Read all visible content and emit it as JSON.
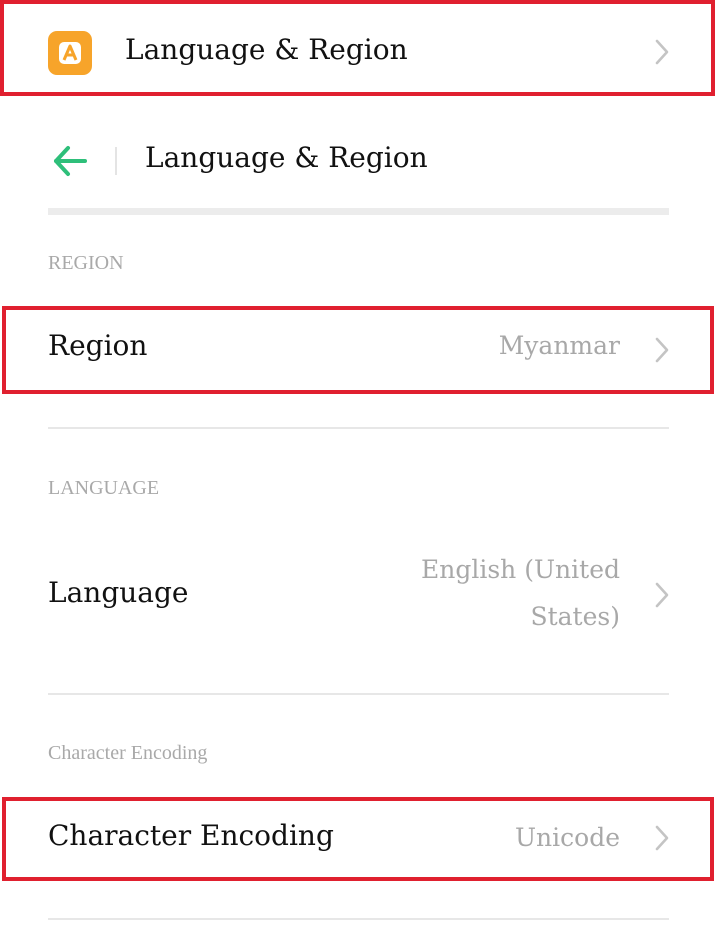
{
  "top_item": {
    "title": "Language & Region",
    "icon": "app-logo-icon",
    "accent": "#f7a42a"
  },
  "header": {
    "back_icon": "back-arrow-icon",
    "title": "Language & Region",
    "accent": "#2ebf7a"
  },
  "sections": {
    "region": {
      "label": "REGION",
      "row": {
        "label": "Region",
        "value": "Myanmar"
      }
    },
    "language": {
      "label": "LANGUAGE",
      "row": {
        "label": "Language",
        "value_line1": "English (United",
        "value_line2": "States)"
      }
    },
    "encoding": {
      "label": "Character Encoding",
      "row": {
        "label": "Character Encoding",
        "value": "Unicode"
      }
    }
  },
  "highlight_color": "#e0202f"
}
